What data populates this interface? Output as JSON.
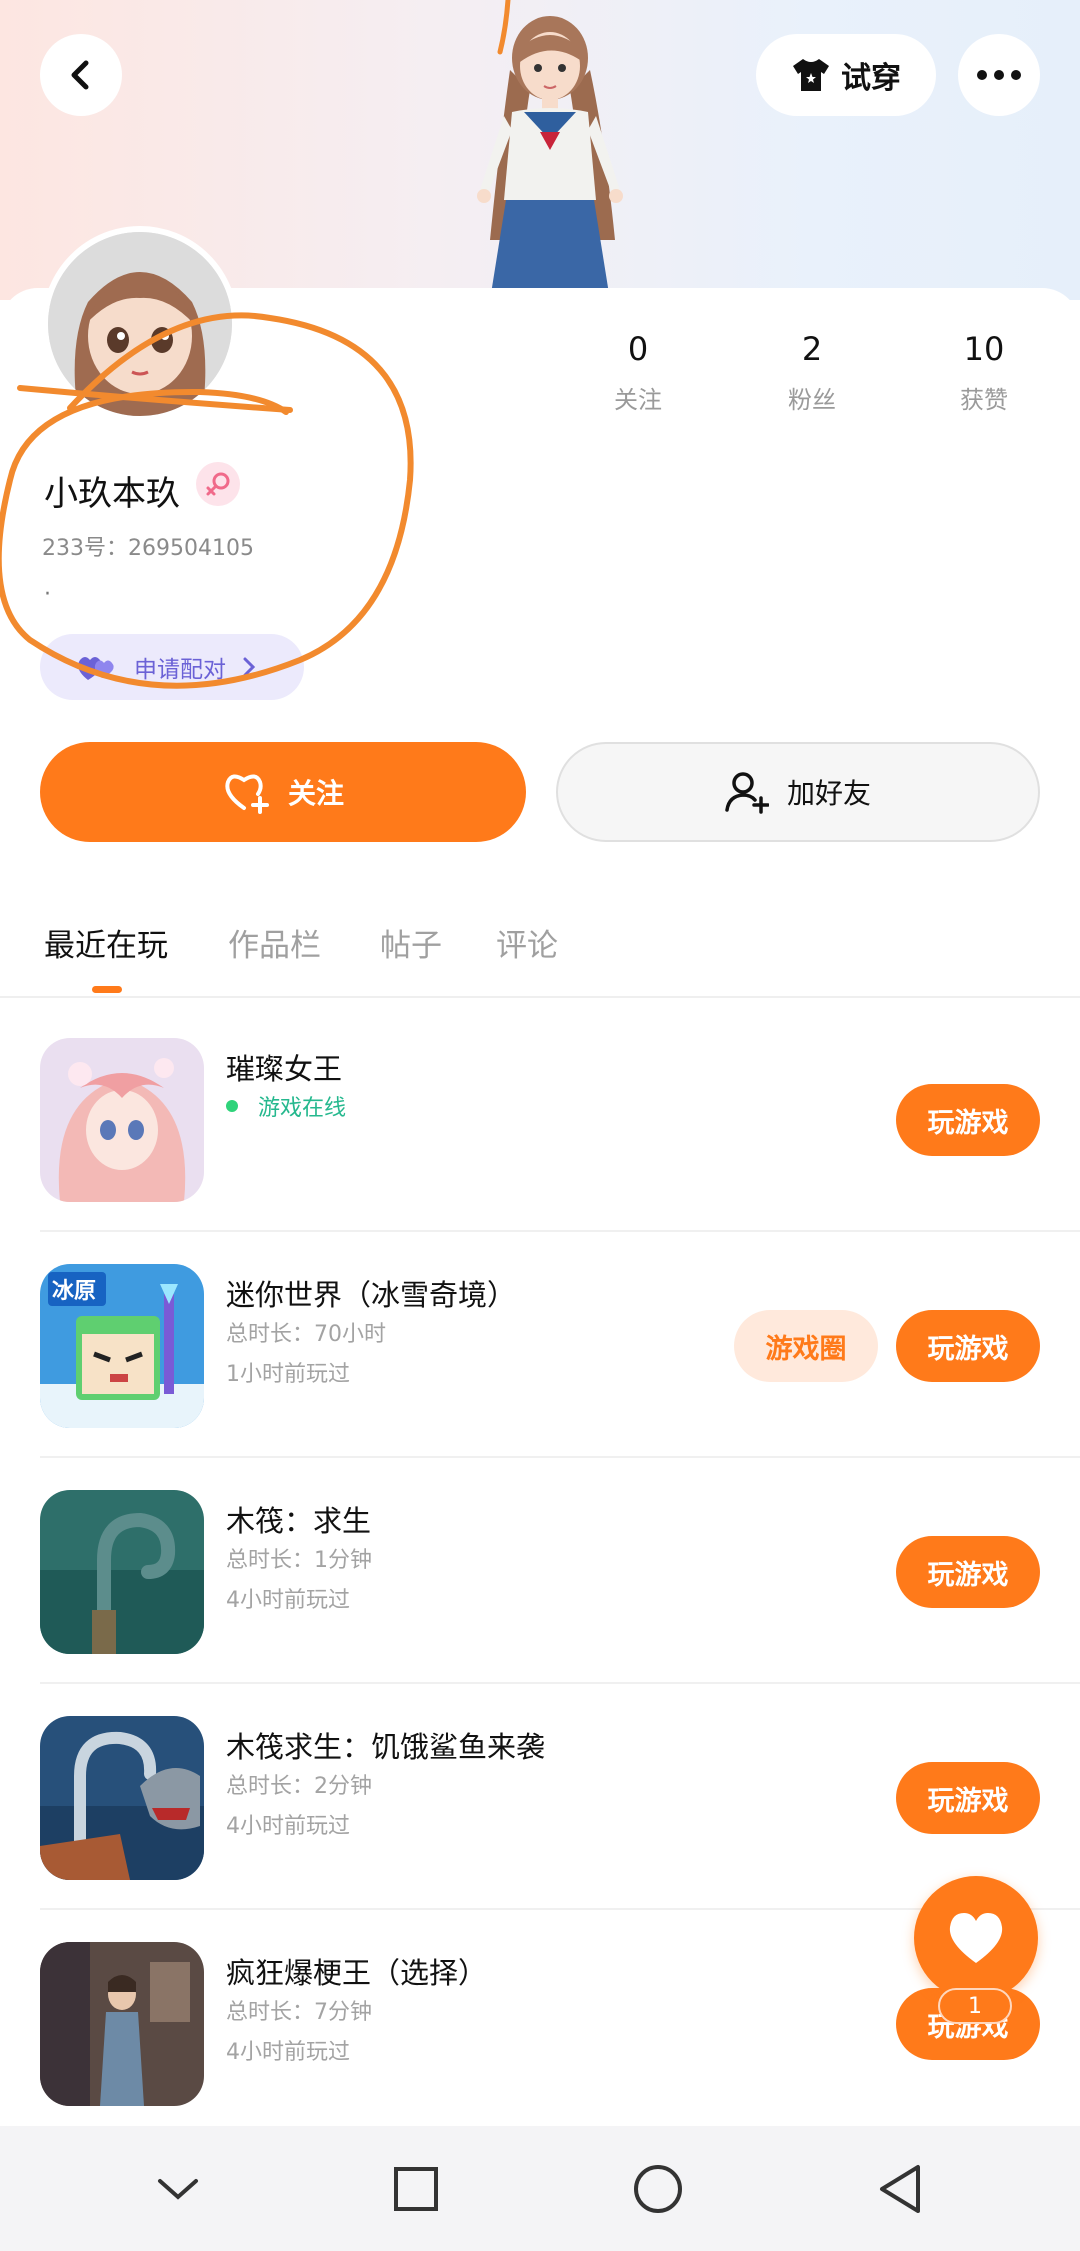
{
  "header": {
    "try_on_label": "试穿"
  },
  "profile": {
    "username": "小玖本玖",
    "uid_label": "233号：269504105",
    "bio": "·",
    "pair_label": "申请配对",
    "stats": [
      {
        "value": "0",
        "label": "关注"
      },
      {
        "value": "2",
        "label": "粉丝"
      },
      {
        "value": "10",
        "label": "获赞"
      }
    ],
    "follow_label": "关注",
    "add_friend_label": "加好友"
  },
  "tabs": [
    "最近在玩",
    "作品栏",
    "帖子",
    "评论"
  ],
  "games": [
    {
      "title": "璀璨女王",
      "status": "游戏在线",
      "play_label": "玩游戏"
    },
    {
      "title": "迷你世界（冰雪奇境）",
      "duration": "总时长：70小时",
      "last_played": "1小时前玩过",
      "circle_label": "游戏圈",
      "play_label": "玩游戏"
    },
    {
      "title": "木筏：求生",
      "duration": "总时长：1分钟",
      "last_played": "4小时前玩过",
      "play_label": "玩游戏"
    },
    {
      "title": "木筏求生：饥饿鲨鱼来袭",
      "duration": "总时长：2分钟",
      "last_played": "4小时前玩过",
      "play_label": "玩游戏"
    },
    {
      "title": "疯狂爆梗王（选择）",
      "duration": "总时长：7分钟",
      "last_played": "4小时前玩过",
      "play_label": "玩游戏"
    }
  ],
  "fab": {
    "count": "1"
  },
  "colors": {
    "accent": "#ff7a1a",
    "online": "#25b88e",
    "pair": "#6b62d6"
  }
}
